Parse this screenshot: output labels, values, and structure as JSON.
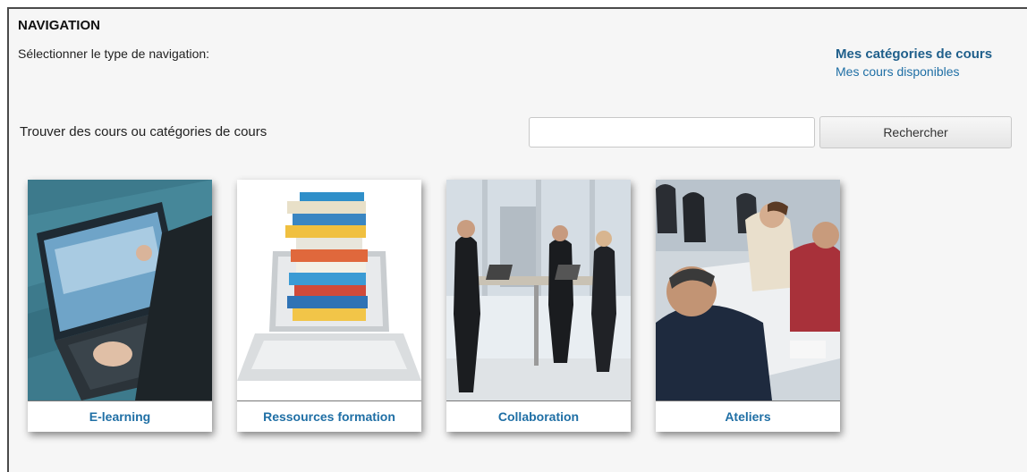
{
  "navigation": {
    "title": "NAVIGATION",
    "subtitle": "Sélectionner le type de navigation:",
    "links": [
      {
        "label": "Mes catégories de cours"
      },
      {
        "label": "Mes cours disponibles"
      }
    ]
  },
  "search": {
    "label": "Trouver des cours ou catégories de cours",
    "value": "",
    "placeholder": "",
    "button_label": "Rechercher"
  },
  "categories": [
    {
      "label": "E-learning",
      "icon": "laptop-elearning-photo"
    },
    {
      "label": "Ressources formation",
      "icon": "books-laptop-photo"
    },
    {
      "label": "Collaboration",
      "icon": "office-meeting-photo"
    },
    {
      "label": "Ateliers",
      "icon": "workshop-table-photo"
    }
  ]
}
